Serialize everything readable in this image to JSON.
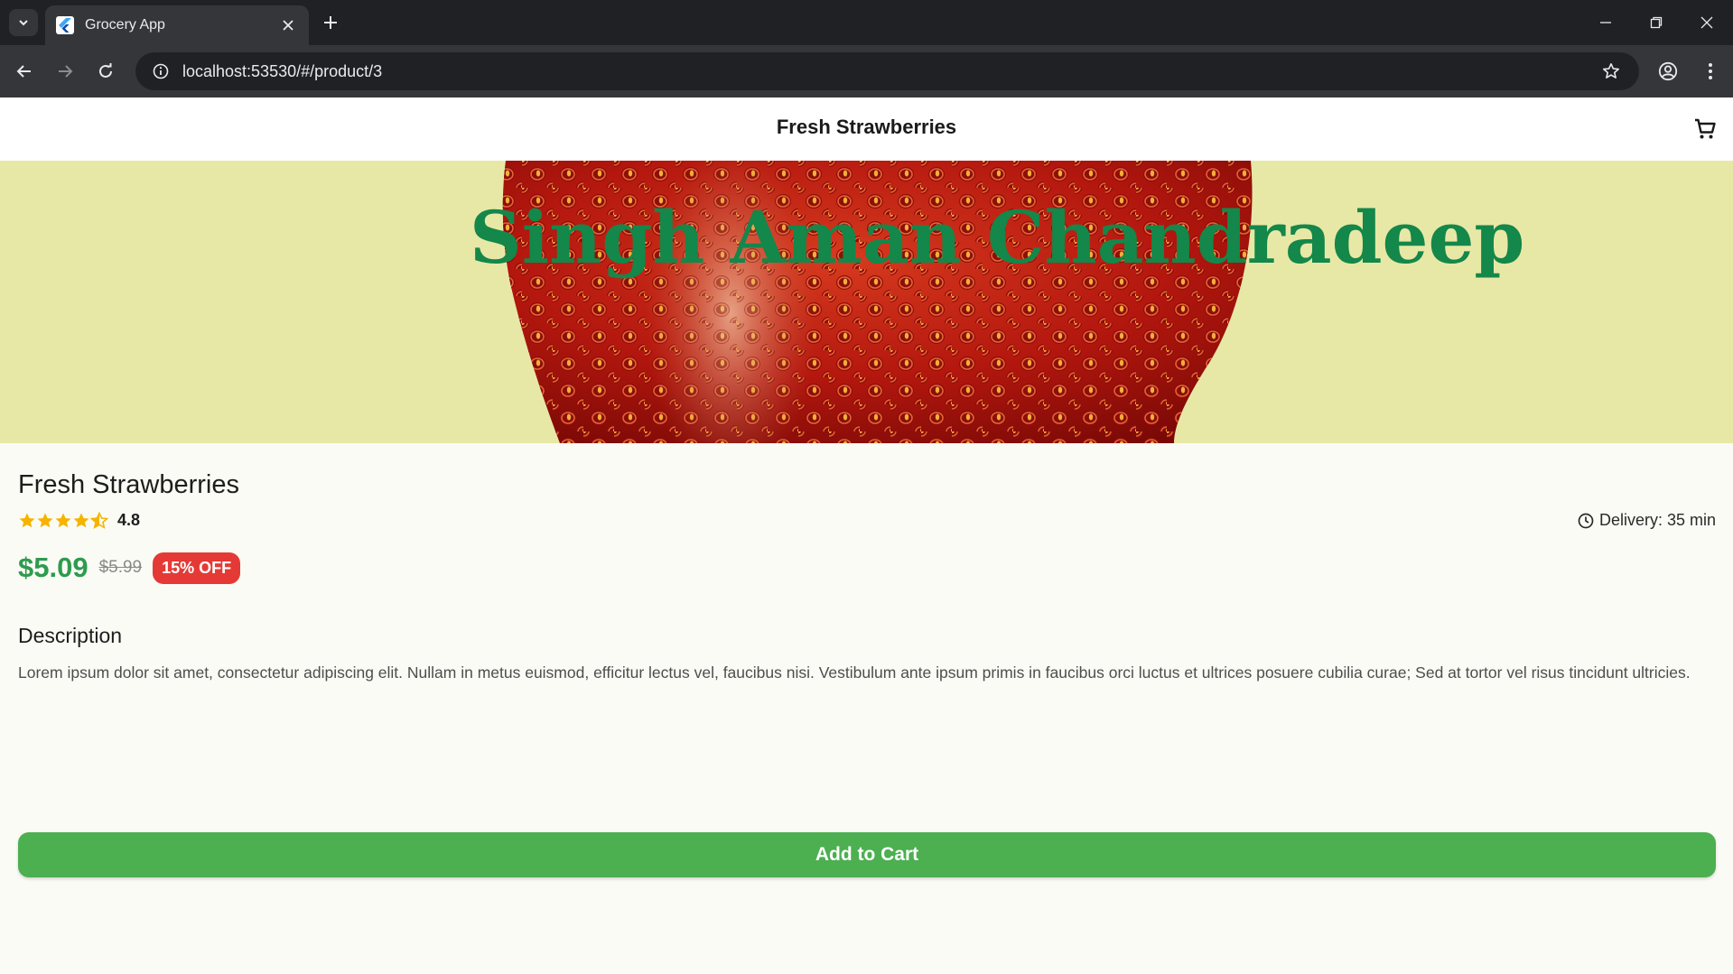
{
  "browser": {
    "tab_title": "Grocery App",
    "url": "localhost:53530/#/product/3",
    "favicon": "flutter-icon"
  },
  "appbar": {
    "title": "Fresh Strawberries",
    "cart_icon": "cart-icon"
  },
  "hero": {
    "image": "strawberry-closeup",
    "background": "#e8e8a6"
  },
  "product": {
    "name": "Fresh Strawberries",
    "rating": "4.8",
    "rating_stars": 4.5,
    "delivery": "Delivery: 35 min",
    "price": "$5.09",
    "old_price": "$5.99",
    "discount": "15% OFF",
    "description_heading": "Description",
    "description": "Lorem ipsum dolor sit amet, consectetur adipiscing elit. Nullam in metus euismod, efficitur lectus vel, faucibus nisi. Vestibulum ante ipsum primis in faucibus orci luctus et ultrices posuere cubilia curae; Sed at tortor vel risus tincidunt ultricies.",
    "add_to_cart": "Add to Cart"
  },
  "watermark": "Singh Aman Chandradeep",
  "colors": {
    "accent_green": "#4caf50",
    "price_green": "#2e9b4f",
    "discount_red": "#e53935",
    "star_amber": "#f5b400"
  }
}
